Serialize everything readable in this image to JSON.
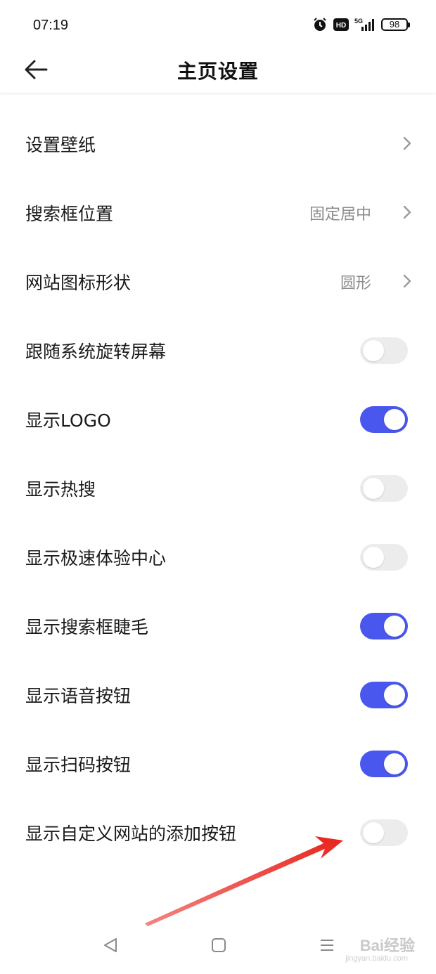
{
  "status_bar": {
    "time": "07:19",
    "network": "5G",
    "hd_label": "HD",
    "battery": "98",
    "icons": [
      "alarm-icon",
      "hd-icon",
      "signal-icon",
      "battery-icon"
    ]
  },
  "header": {
    "title": "主页设置",
    "back_icon": "arrow-left-icon"
  },
  "settings": [
    {
      "label": "设置壁纸",
      "type": "link",
      "value": ""
    },
    {
      "label": "搜索框位置",
      "type": "link",
      "value": "固定居中"
    },
    {
      "label": "网站图标形状",
      "type": "link",
      "value": "圆形"
    },
    {
      "label": "跟随系统旋转屏幕",
      "type": "toggle",
      "on": false
    },
    {
      "label": "显示LOGO",
      "type": "toggle",
      "on": true
    },
    {
      "label": "显示热搜",
      "type": "toggle",
      "on": false
    },
    {
      "label": "显示极速体验中心",
      "type": "toggle",
      "on": false
    },
    {
      "label": "显示搜索框睫毛",
      "type": "toggle",
      "on": true
    },
    {
      "label": "显示语音按钮",
      "type": "toggle",
      "on": true
    },
    {
      "label": "显示扫码按钮",
      "type": "toggle",
      "on": true
    },
    {
      "label": "显示自定义网站的添加按钮",
      "type": "toggle",
      "on": false
    }
  ],
  "colors": {
    "toggle_on": "#4a57ee",
    "toggle_off": "#ececec",
    "annotation_arrow": "#e8231c"
  },
  "nav_bar": {
    "icons": [
      "back-triangle-icon",
      "home-square-icon",
      "menu-lines-icon"
    ]
  },
  "watermark": {
    "text": "Bai经验",
    "sub": "jingyan.baidu.com"
  }
}
